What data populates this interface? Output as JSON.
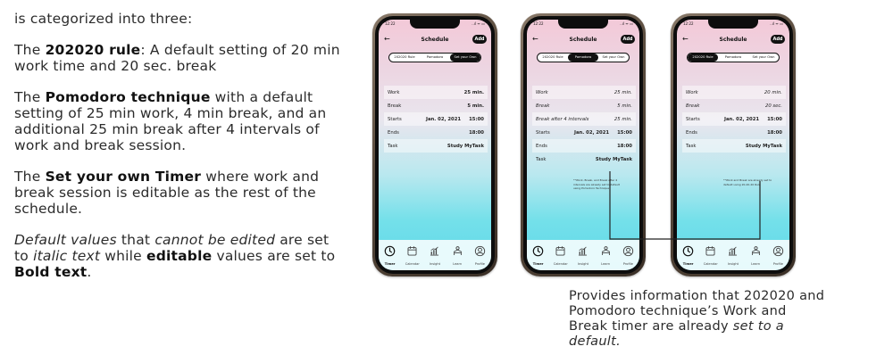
{
  "description": {
    "intro": "is categorized into three:",
    "p1": {
      "bold": "202020 rule",
      "rest": ": A default setting of 20 min work time and 20 sec. break"
    },
    "p2": {
      "pre": "The ",
      "bold": "Pomodoro technique",
      "rest": " with a default setting of 25 min work, 4 min break, and an additional 25 min break after 4 intervals of work and break session."
    },
    "p3": {
      "pre": "The ",
      "bold": "Set your own Timer",
      "rest": " where work and break session is editable as the rest of the schedule."
    },
    "p4": {
      "it1": "Default values",
      "t1": " that ",
      "it2": "cannot be edited",
      "t2": " are set to ",
      "it3": "italic text",
      "t3": " while ",
      "b1": "editable",
      "t4": " values are set to ",
      "b2": "Bold text",
      "t5": "."
    },
    "the": "The "
  },
  "app": {
    "status_time": "12:22",
    "status_icons": "..ıl ᯤ ▭",
    "title": "Schedule",
    "add": "Add",
    "tabs": [
      "202020 Rule",
      "Pomodoro",
      "Set your Own"
    ],
    "nav": [
      "Timer",
      "Calendar",
      "Insight",
      "Learn",
      "Profile"
    ]
  },
  "phones": [
    {
      "active_tab": "Set your Own",
      "rows": [
        {
          "label": "Work",
          "value": "25 min."
        },
        {
          "label": "Break",
          "value": "5 min."
        },
        {
          "label": "Starts",
          "date": "Jan. 02, 2021",
          "time": "15:00"
        },
        {
          "label": "Ends",
          "value": "18:00"
        },
        {
          "label": "Task",
          "value": "Study MyTask"
        }
      ]
    },
    {
      "active_tab": "Pomodoro",
      "rows": [
        {
          "label": "Work",
          "value": "25 min."
        },
        {
          "label": "Break",
          "value": "5 min."
        },
        {
          "label": "Break after 4 intervals",
          "value": "25 min."
        },
        {
          "label": "Starts",
          "date": "Jan. 02, 2021",
          "time": "15:00"
        },
        {
          "label": "Ends",
          "value": "18:00"
        },
        {
          "label": "Task",
          "value": "Study MyTask"
        }
      ],
      "note": "**Work, Break, and Break after 4 intervals are already set to default using Pomodoro Technique"
    },
    {
      "active_tab": "202020 Rule",
      "rows": [
        {
          "label": "Work",
          "value": "20 min."
        },
        {
          "label": "Break",
          "value": "20 sec."
        },
        {
          "label": "Starts",
          "date": "Jan. 02, 2021",
          "time": "15:00"
        },
        {
          "label": "Ends",
          "value": "18:00"
        },
        {
          "label": "Task",
          "value": "Study MyTask"
        }
      ],
      "note": "**Work and Break are already set to default using 20-20-20 Rule"
    }
  ],
  "callout": {
    "text": "Provides information that 202020 and Pomodoro technique’s Work and Break timer are already ",
    "italic": "set to a default."
  }
}
